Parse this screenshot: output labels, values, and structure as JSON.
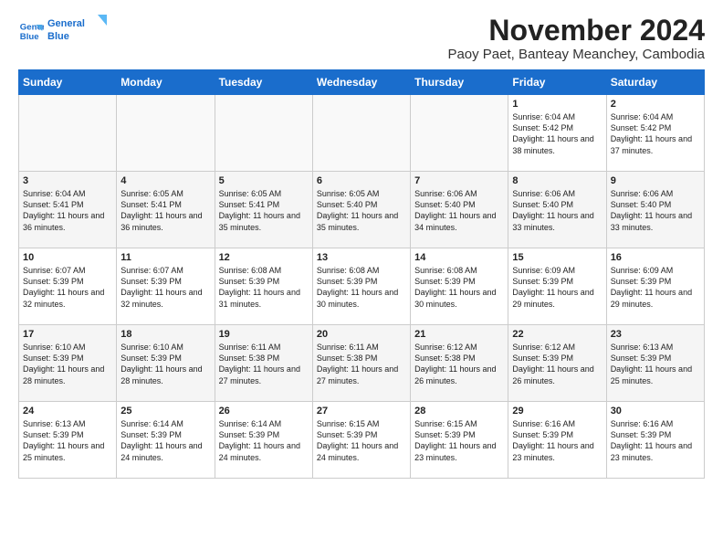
{
  "logo": {
    "line1": "General",
    "line2": "Blue"
  },
  "title": "November 2024",
  "subtitle": "Paoy Paet, Banteay Meanchey, Cambodia",
  "days_header": [
    "Sunday",
    "Monday",
    "Tuesday",
    "Wednesday",
    "Thursday",
    "Friday",
    "Saturday"
  ],
  "weeks": [
    [
      {
        "num": "",
        "info": ""
      },
      {
        "num": "",
        "info": ""
      },
      {
        "num": "",
        "info": ""
      },
      {
        "num": "",
        "info": ""
      },
      {
        "num": "",
        "info": ""
      },
      {
        "num": "1",
        "info": "Sunrise: 6:04 AM\nSunset: 5:42 PM\nDaylight: 11 hours and 38 minutes."
      },
      {
        "num": "2",
        "info": "Sunrise: 6:04 AM\nSunset: 5:42 PM\nDaylight: 11 hours and 37 minutes."
      }
    ],
    [
      {
        "num": "3",
        "info": "Sunrise: 6:04 AM\nSunset: 5:41 PM\nDaylight: 11 hours and 36 minutes."
      },
      {
        "num": "4",
        "info": "Sunrise: 6:05 AM\nSunset: 5:41 PM\nDaylight: 11 hours and 36 minutes."
      },
      {
        "num": "5",
        "info": "Sunrise: 6:05 AM\nSunset: 5:41 PM\nDaylight: 11 hours and 35 minutes."
      },
      {
        "num": "6",
        "info": "Sunrise: 6:05 AM\nSunset: 5:40 PM\nDaylight: 11 hours and 35 minutes."
      },
      {
        "num": "7",
        "info": "Sunrise: 6:06 AM\nSunset: 5:40 PM\nDaylight: 11 hours and 34 minutes."
      },
      {
        "num": "8",
        "info": "Sunrise: 6:06 AM\nSunset: 5:40 PM\nDaylight: 11 hours and 33 minutes."
      },
      {
        "num": "9",
        "info": "Sunrise: 6:06 AM\nSunset: 5:40 PM\nDaylight: 11 hours and 33 minutes."
      }
    ],
    [
      {
        "num": "10",
        "info": "Sunrise: 6:07 AM\nSunset: 5:39 PM\nDaylight: 11 hours and 32 minutes."
      },
      {
        "num": "11",
        "info": "Sunrise: 6:07 AM\nSunset: 5:39 PM\nDaylight: 11 hours and 32 minutes."
      },
      {
        "num": "12",
        "info": "Sunrise: 6:08 AM\nSunset: 5:39 PM\nDaylight: 11 hours and 31 minutes."
      },
      {
        "num": "13",
        "info": "Sunrise: 6:08 AM\nSunset: 5:39 PM\nDaylight: 11 hours and 30 minutes."
      },
      {
        "num": "14",
        "info": "Sunrise: 6:08 AM\nSunset: 5:39 PM\nDaylight: 11 hours and 30 minutes."
      },
      {
        "num": "15",
        "info": "Sunrise: 6:09 AM\nSunset: 5:39 PM\nDaylight: 11 hours and 29 minutes."
      },
      {
        "num": "16",
        "info": "Sunrise: 6:09 AM\nSunset: 5:39 PM\nDaylight: 11 hours and 29 minutes."
      }
    ],
    [
      {
        "num": "17",
        "info": "Sunrise: 6:10 AM\nSunset: 5:39 PM\nDaylight: 11 hours and 28 minutes."
      },
      {
        "num": "18",
        "info": "Sunrise: 6:10 AM\nSunset: 5:39 PM\nDaylight: 11 hours and 28 minutes."
      },
      {
        "num": "19",
        "info": "Sunrise: 6:11 AM\nSunset: 5:38 PM\nDaylight: 11 hours and 27 minutes."
      },
      {
        "num": "20",
        "info": "Sunrise: 6:11 AM\nSunset: 5:38 PM\nDaylight: 11 hours and 27 minutes."
      },
      {
        "num": "21",
        "info": "Sunrise: 6:12 AM\nSunset: 5:38 PM\nDaylight: 11 hours and 26 minutes."
      },
      {
        "num": "22",
        "info": "Sunrise: 6:12 AM\nSunset: 5:39 PM\nDaylight: 11 hours and 26 minutes."
      },
      {
        "num": "23",
        "info": "Sunrise: 6:13 AM\nSunset: 5:39 PM\nDaylight: 11 hours and 25 minutes."
      }
    ],
    [
      {
        "num": "24",
        "info": "Sunrise: 6:13 AM\nSunset: 5:39 PM\nDaylight: 11 hours and 25 minutes."
      },
      {
        "num": "25",
        "info": "Sunrise: 6:14 AM\nSunset: 5:39 PM\nDaylight: 11 hours and 24 minutes."
      },
      {
        "num": "26",
        "info": "Sunrise: 6:14 AM\nSunset: 5:39 PM\nDaylight: 11 hours and 24 minutes."
      },
      {
        "num": "27",
        "info": "Sunrise: 6:15 AM\nSunset: 5:39 PM\nDaylight: 11 hours and 24 minutes."
      },
      {
        "num": "28",
        "info": "Sunrise: 6:15 AM\nSunset: 5:39 PM\nDaylight: 11 hours and 23 minutes."
      },
      {
        "num": "29",
        "info": "Sunrise: 6:16 AM\nSunset: 5:39 PM\nDaylight: 11 hours and 23 minutes."
      },
      {
        "num": "30",
        "info": "Sunrise: 6:16 AM\nSunset: 5:39 PM\nDaylight: 11 hours and 23 minutes."
      }
    ]
  ]
}
